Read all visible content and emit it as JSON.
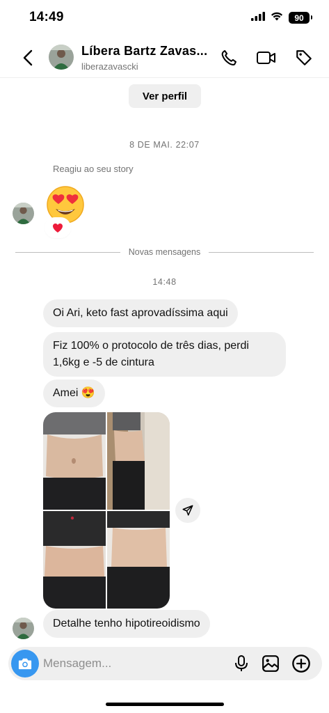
{
  "status_bar": {
    "time": "14:49",
    "battery": "90",
    "icons": [
      "signal-icon",
      "wifi-icon",
      "battery-icon"
    ]
  },
  "header": {
    "contact_name": "Líbera Bartz Zavas...",
    "username": "liberazavascki",
    "icons": [
      "back-icon",
      "phone-icon",
      "video-icon",
      "tag-icon"
    ]
  },
  "chat": {
    "view_profile_label": "Ver perfil",
    "date_stamp": "8 DE MAI. 22:07",
    "reacted_label": "Reagiu ao seu story",
    "story_reaction_emoji": "😍",
    "reaction_pill_emoji": "❤️",
    "new_messages_label": "Novas mensagens",
    "time_stamp": "14:48",
    "messages": [
      {
        "text": "Oi Ari, keto fast aprovadíssima aqui"
      },
      {
        "text_line1": "Fiz 100% o protocolo de três dias, perdi",
        "text_line2": "1,6kg e -5 de cintura"
      },
      {
        "text": "Amei",
        "emoji": "😍"
      },
      {
        "type": "photo",
        "description_icon": "photo-grid"
      },
      {
        "text": "Detalhe tenho hipotireoidismo"
      }
    ]
  },
  "composer": {
    "placeholder": "Mensagem...",
    "icons": [
      "camera-icon",
      "microphone-icon",
      "gallery-icon",
      "add-icon"
    ]
  },
  "colors": {
    "accent": "#3797f0",
    "bubble": "#efefef",
    "muted_text": "#737373",
    "heart": "#ed1c3b"
  }
}
